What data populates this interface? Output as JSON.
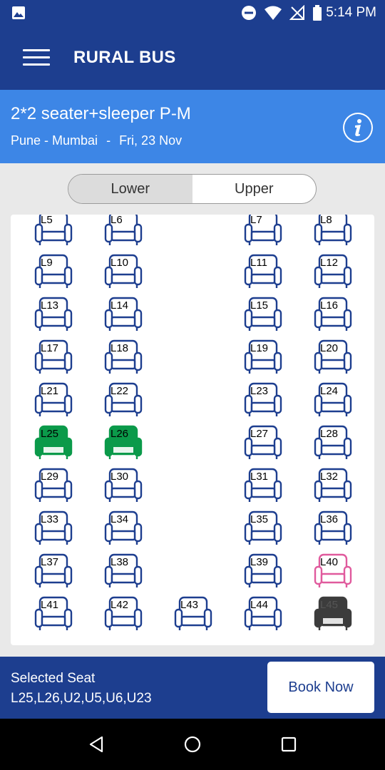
{
  "status_bar": {
    "time": "5:14 PM",
    "icons": [
      "image-icon",
      "do-not-disturb-icon",
      "wifi-icon",
      "no-signal-icon",
      "battery-icon"
    ]
  },
  "app_bar": {
    "menu_icon": "hamburger-menu-icon",
    "title": "RURAL BUS"
  },
  "trip": {
    "bus_type": "2*2 seater+sleeper P-M",
    "route": "Pune - Mumbai",
    "separator": "-",
    "date": "Fri, 23 Nov",
    "info_icon": "info-icon"
  },
  "deck_toggle": {
    "lower": "Lower",
    "upper": "Upper",
    "active": "lower"
  },
  "seats": [
    {
      "label": "L5",
      "status": "available"
    },
    {
      "label": "L6",
      "status": "available"
    },
    {
      "label": "L7",
      "status": "available"
    },
    {
      "label": "L8",
      "status": "available"
    },
    {
      "label": "L9",
      "status": "available"
    },
    {
      "label": "L10",
      "status": "available"
    },
    {
      "label": "L11",
      "status": "available"
    },
    {
      "label": "L12",
      "status": "available"
    },
    {
      "label": "L13",
      "status": "available"
    },
    {
      "label": "L14",
      "status": "available"
    },
    {
      "label": "L15",
      "status": "available"
    },
    {
      "label": "L16",
      "status": "available"
    },
    {
      "label": "L17",
      "status": "available"
    },
    {
      "label": "L18",
      "status": "available"
    },
    {
      "label": "L19",
      "status": "available"
    },
    {
      "label": "L20",
      "status": "available"
    },
    {
      "label": "L21",
      "status": "available"
    },
    {
      "label": "L22",
      "status": "available"
    },
    {
      "label": "L23",
      "status": "available"
    },
    {
      "label": "L24",
      "status": "available"
    },
    {
      "label": "L25",
      "status": "selected"
    },
    {
      "label": "L26",
      "status": "selected"
    },
    {
      "label": "L27",
      "status": "available"
    },
    {
      "label": "L28",
      "status": "available"
    },
    {
      "label": "L29",
      "status": "available"
    },
    {
      "label": "L30",
      "status": "available"
    },
    {
      "label": "L31",
      "status": "available"
    },
    {
      "label": "L32",
      "status": "available"
    },
    {
      "label": "L33",
      "status": "available"
    },
    {
      "label": "L34",
      "status": "available"
    },
    {
      "label": "L35",
      "status": "available"
    },
    {
      "label": "L36",
      "status": "available"
    },
    {
      "label": "L37",
      "status": "available"
    },
    {
      "label": "L38",
      "status": "available"
    },
    {
      "label": "L39",
      "status": "available"
    },
    {
      "label": "L40",
      "status": "ladies"
    },
    {
      "label": "L41",
      "status": "available"
    },
    {
      "label": "L42",
      "status": "available"
    },
    {
      "label": "L43",
      "status": "available"
    },
    {
      "label": "L44",
      "status": "available"
    },
    {
      "label": "L45",
      "status": "booked"
    }
  ],
  "seat_colors": {
    "available": "#1d3e8f",
    "selected": "#0b9a4a",
    "ladies": "#e05a9d",
    "booked": "#3c3c3c"
  },
  "selection": {
    "title": "Selected Seat",
    "seats": "L25,L26,U2,U5,U6,U23"
  },
  "book_button": "Book Now",
  "nav": {
    "back": "back-icon",
    "home": "home-icon",
    "recents": "recents-icon"
  },
  "colors": {
    "primary": "#1d3e8f",
    "route_bar": "#3d86e6"
  }
}
